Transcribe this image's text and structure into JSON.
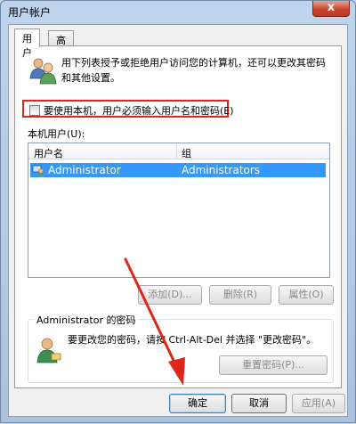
{
  "window": {
    "title": "用户帐户",
    "close_glyph": "x"
  },
  "tabs": [
    {
      "label": "用户",
      "active": true
    },
    {
      "label": "高级",
      "active": false
    }
  ],
  "description": "用下列表授予或拒绝用户访问您的计算机，还可以更改其密码和其他设置。",
  "require_login_checkbox": {
    "label": "要使用本机，用户必须输入用户名和密码(E)",
    "checked": false
  },
  "local_users": {
    "label": "本机用户(U):",
    "columns": [
      "用户名",
      "组"
    ],
    "rows": [
      {
        "username": "Administrator",
        "group": "Administrators",
        "selected": true
      }
    ]
  },
  "list_buttons": {
    "add": "添加(D)...",
    "remove": "删除(R)",
    "properties": "属性(O)"
  },
  "password_group": {
    "title": "Administrator 的密码",
    "text": "要更改您的密码，请按 Ctrl-Alt-Del 并选择 \"更改密码\"。",
    "reset_button": "重置密码(P)..."
  },
  "dialog_buttons": {
    "ok": "确定",
    "cancel": "取消",
    "apply": "应用(A)"
  },
  "colors": {
    "highlight_border": "#e0261a",
    "selection": "#3399ff",
    "annotation_arrow": "#e0261a"
  }
}
